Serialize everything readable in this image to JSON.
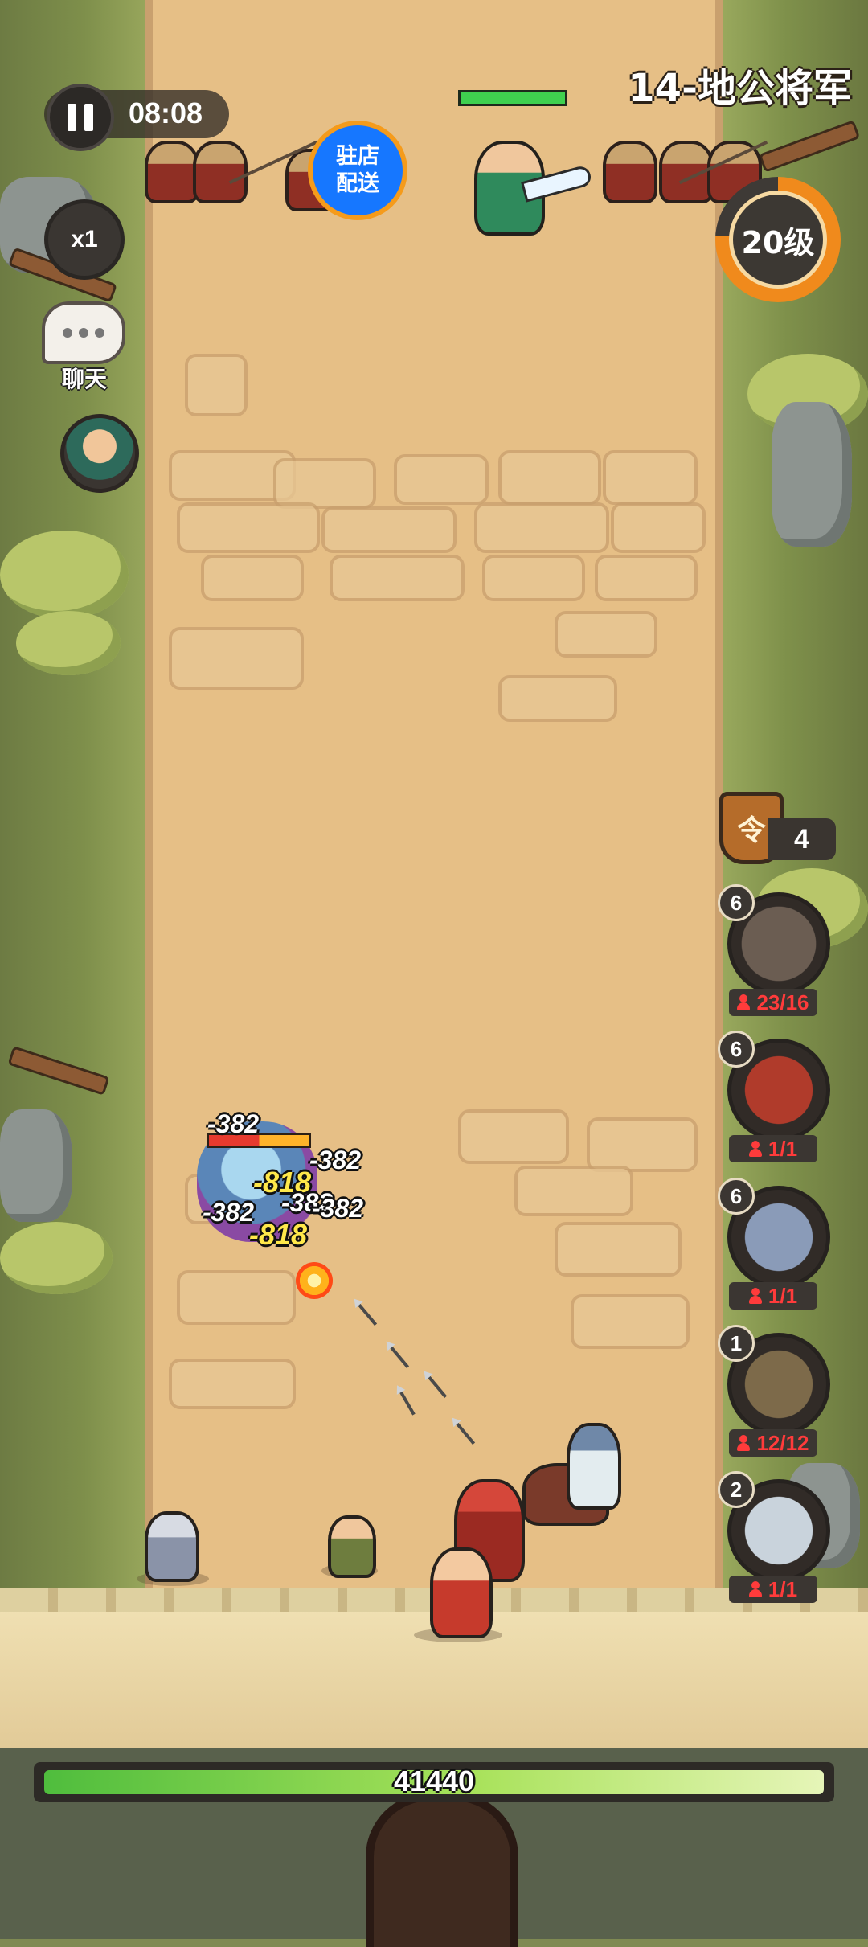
{
  "hud": {
    "timer": "08:08",
    "speed": "x1",
    "chat_label": "聊天",
    "stage_title": "14-地公将军",
    "level": "20级",
    "level_progress": 0.76,
    "boss_hp_fraction": 1.0,
    "shop_button": {
      "line1": "驻店",
      "line2": "配送"
    }
  },
  "command": {
    "count": "4",
    "icon_char": "令"
  },
  "units": [
    {
      "level": "6",
      "count": "23/16"
    },
    {
      "level": "6",
      "count": "1/1"
    },
    {
      "level": "6",
      "count": "1/1"
    },
    {
      "level": "1",
      "count": "12/12"
    },
    {
      "level": "2",
      "count": "1/1"
    }
  ],
  "combat": {
    "damage_numbers": [
      "-382",
      "-382",
      "-818",
      "-382",
      "-382",
      "-382",
      "-818"
    ],
    "monster_hp_fraction": 0.5
  },
  "wall": {
    "hp": "41440"
  },
  "colors": {
    "road": "#e6bf86",
    "grass": "#7e8f4b",
    "level_ring": "#f08a1c",
    "shop_blue": "#1677ff",
    "hp_green": "#4fbd3d",
    "unit_count_red": "#ff3b3b"
  },
  "icons": [
    "pause-icon",
    "chat-icon",
    "person-icon",
    "command-token-icon"
  ]
}
